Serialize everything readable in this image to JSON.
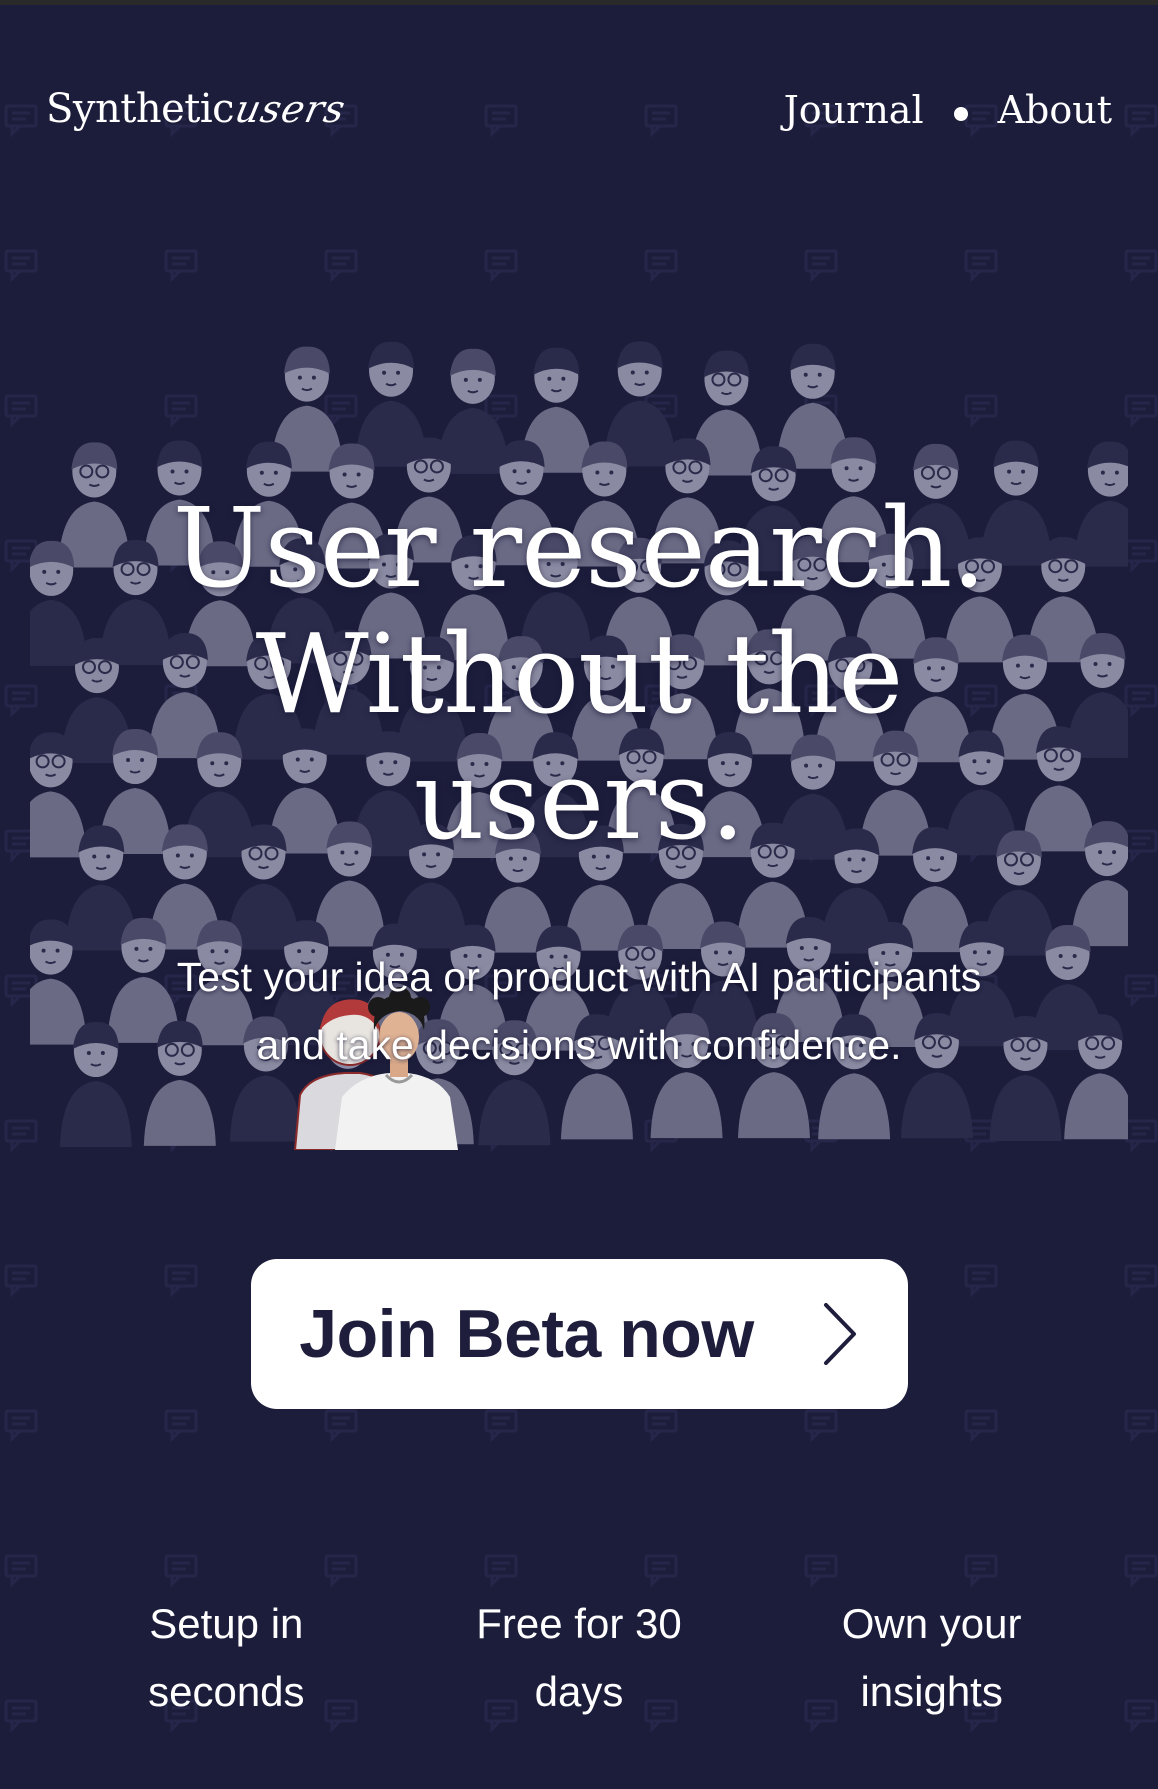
{
  "header": {
    "logo_main": "Synthetic",
    "logo_script": "users",
    "nav": [
      {
        "label": "Journal"
      },
      {
        "label": "About"
      }
    ]
  },
  "hero": {
    "title_lines": [
      "User research.",
      "Without the",
      "users."
    ],
    "subtitle_lines": [
      "Test your idea or product with AI participants",
      "and take decisions with confidence."
    ]
  },
  "cta": {
    "label": "Join Beta now",
    "icon": "chevron-right-icon"
  },
  "features": [
    {
      "line1": "Setup in",
      "line2": "seconds"
    },
    {
      "line1": "Free for 30",
      "line2": "days"
    },
    {
      "line1": "Own your",
      "line2": "insights"
    }
  ],
  "colors": {
    "background": "#1c1c3b",
    "crowd": "#6a6a85",
    "button_bg": "#ffffff",
    "button_text": "#1e1e3c"
  }
}
